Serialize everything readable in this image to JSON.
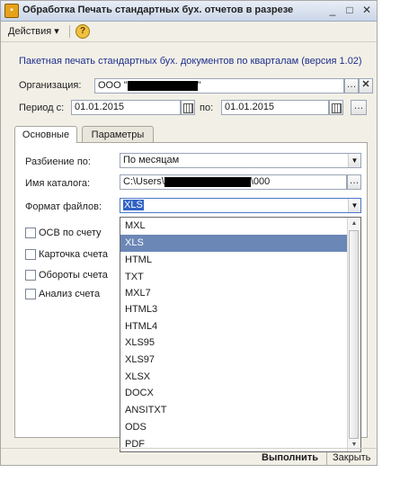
{
  "window": {
    "title": "Обработка  Печать стандартных бух. отчетов в разрезе"
  },
  "menu": {
    "actions_label": "Действия",
    "help_icon": "?"
  },
  "description": "Пакетная печать стандартных бух. документов  по кварталам (версия 1.02)",
  "organization": {
    "label": "Организация:",
    "value_prefix": "ООО \"",
    "value_suffix": "\""
  },
  "period": {
    "from_label": "Период с:",
    "from_value": "01.01.2015",
    "to_label": "по:",
    "to_value": "01.01.2015"
  },
  "tabs": [
    {
      "label": "Основные"
    },
    {
      "label": "Параметры"
    }
  ],
  "split": {
    "label": "Разбиение по:",
    "value": "По месяцам"
  },
  "catalog": {
    "label": "Имя каталога:",
    "value_prefix": "C:\\Users\\",
    "value_suffix": "\\000"
  },
  "format": {
    "label": "Формат файлов:",
    "value": "XLS"
  },
  "checkboxes": [
    {
      "label": "ОСВ по счету",
      "checked": false
    },
    {
      "label": "Карточка счета",
      "checked": false
    },
    {
      "label": "Обороты счета",
      "checked": false
    },
    {
      "label": "Анализ счета",
      "checked": false
    }
  ],
  "dropdown": {
    "options": [
      "MXL",
      "XLS",
      "HTML",
      "TXT",
      "MXL7",
      "HTML3",
      "HTML4",
      "XLS95",
      "XLS97",
      "XLSX",
      "DOCX",
      "ANSITXT",
      "ODS",
      "PDF"
    ],
    "selected": "XLS"
  },
  "footer": {
    "run_label": "Выполнить",
    "close_label": "Закрыть"
  }
}
